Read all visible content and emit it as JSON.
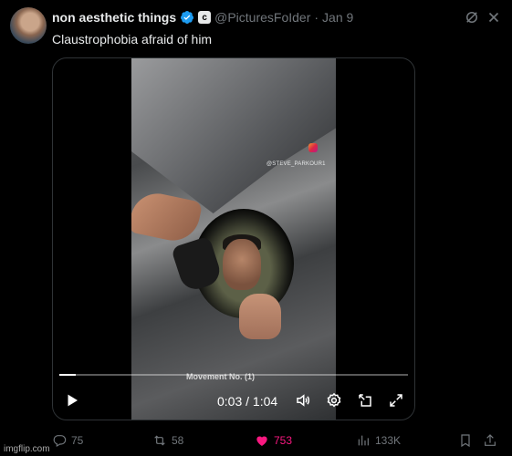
{
  "author": {
    "display_name": "non aesthetic things",
    "handle": "@PicturesFoIder",
    "affiliate_badge": "c",
    "separator": "·",
    "date": "Jan 9",
    "verified_color": "#1d9bf0"
  },
  "tweet": {
    "text": "Claustrophobia afraid of him"
  },
  "video": {
    "watermark": "@STEVE_PARKOUR1",
    "caption": "Movement No. (1)",
    "time": "0:03 / 1:04",
    "progress": 0.047,
    "icons": [
      "play-icon",
      "volume-icon",
      "settings-gear-icon",
      "picture-in-picture-icon",
      "fullscreen-icon"
    ]
  },
  "actions": {
    "replies": "75",
    "reposts": "58",
    "likes": "753",
    "views": "133K",
    "like_color": "#f91880"
  },
  "header_icons": [
    "grok-icon",
    "more-icon"
  ],
  "watermark_site": "imgflip.com"
}
